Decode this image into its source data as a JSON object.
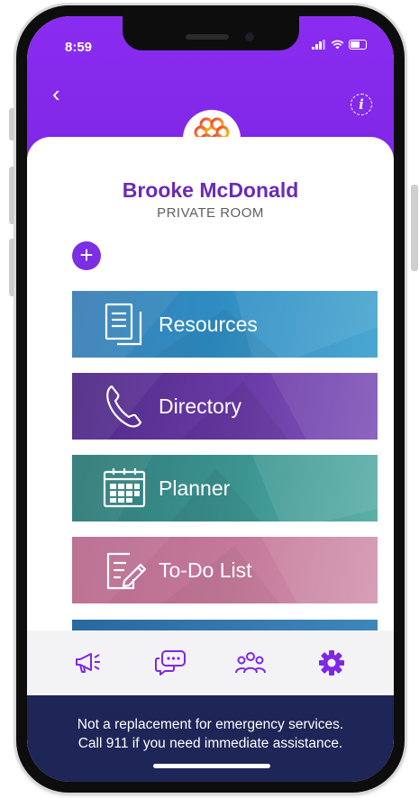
{
  "status": {
    "time": "8:59"
  },
  "profile": {
    "name": "Brooke McDonald",
    "room_type": "PRIVATE ROOM"
  },
  "tiles": [
    {
      "label": "Resources",
      "icon": "document-icon",
      "color": "#2e8cc2"
    },
    {
      "label": "Directory",
      "icon": "phone-icon",
      "color": "#6a3aa6"
    },
    {
      "label": "Planner",
      "icon": "calendar-icon",
      "color": "#3c9491"
    },
    {
      "label": "To-Do List",
      "icon": "checklist-pencil-icon",
      "color": "#c57a9b"
    }
  ],
  "bottom_nav": [
    {
      "icon": "megaphone-icon"
    },
    {
      "icon": "chat-icon"
    },
    {
      "icon": "people-icon"
    },
    {
      "icon": "gear-icon"
    }
  ],
  "footer": {
    "line1": "Not a replacement for emergency services.",
    "line2": "Call 911 if you need immediate assistance."
  },
  "colors": {
    "accent": "#7f27e6",
    "name_text": "#6a2bb7",
    "footer_bg": "#1e2557"
  }
}
